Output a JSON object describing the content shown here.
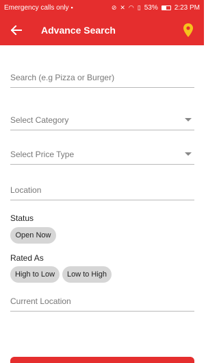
{
  "status_bar": {
    "carrier_text": "Emergency calls only",
    "battery_percent": "53%",
    "battery_level": 0.53,
    "time": "2:23 PM"
  },
  "app_bar": {
    "title": "Advance Search",
    "back_icon": "arrow-left-icon",
    "location_icon": "map-pin-icon",
    "color": "#e52e2e"
  },
  "form": {
    "search_placeholder": "Search (e.g Pizza or Burger)",
    "category_placeholder": "Select Category",
    "price_type_placeholder": "Select Price Type",
    "location_placeholder": "Location",
    "current_location_placeholder": "Current Location"
  },
  "status_section": {
    "label": "Status",
    "chips": [
      "Open Now"
    ]
  },
  "rated_section": {
    "label": "Rated As",
    "chips": [
      "High to Low",
      "Low to High"
    ]
  }
}
